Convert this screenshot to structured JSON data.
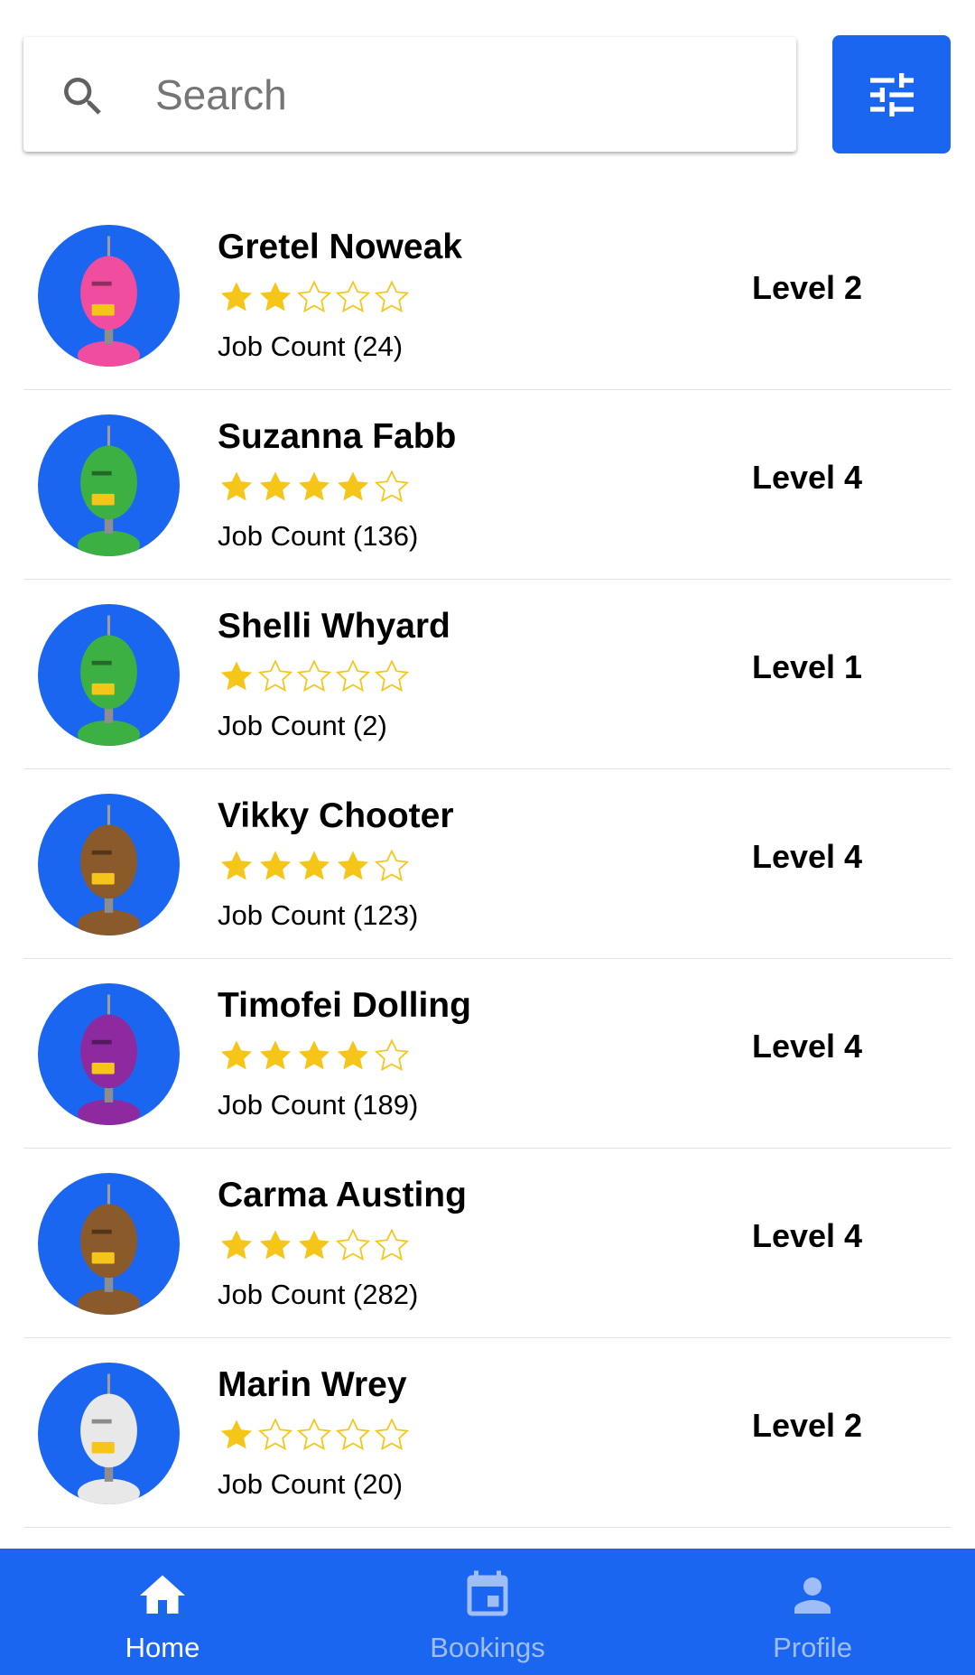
{
  "search": {
    "placeholder": "Search",
    "value": ""
  },
  "accent_color": "#1a66f0",
  "star_color": "#f5c518",
  "workers": [
    {
      "name": "Gretel Noweak",
      "rating": 2,
      "job_count": "Job Count (24)",
      "level": "Level 2",
      "avatar_color": "#f04d9e",
      "avatar_icon": "pink-robot"
    },
    {
      "name": "Suzanna Fabb",
      "rating": 4,
      "job_count": "Job Count (136)",
      "level": "Level 4",
      "avatar_color": "#3cb043",
      "avatar_icon": "green-robot"
    },
    {
      "name": "Shelli Whyard",
      "rating": 1,
      "job_count": "Job Count (2)",
      "level": "Level 1",
      "avatar_color": "#3cb043",
      "avatar_icon": "green-cyclops-robot"
    },
    {
      "name": "Vikky Chooter",
      "rating": 4,
      "job_count": "Job Count (123)",
      "level": "Level 4",
      "avatar_color": "#8b5a2b",
      "avatar_icon": "brown-robot"
    },
    {
      "name": "Timofei Dolling",
      "rating": 4,
      "job_count": "Job Count (189)",
      "level": "Level 4",
      "avatar_color": "#8e2aa0",
      "avatar_icon": "purple-robot"
    },
    {
      "name": "Carma Austing",
      "rating": 3,
      "job_count": "Job Count (282)",
      "level": "Level 4",
      "avatar_color": "#8b5a2b",
      "avatar_icon": "brown-robot"
    },
    {
      "name": "Marin Wrey",
      "rating": 1,
      "job_count": "Job Count (20)",
      "level": "Level 2",
      "avatar_color": "#e8e8e8",
      "avatar_icon": "white-robot"
    }
  ],
  "nav": {
    "home": "Home",
    "bookings": "Bookings",
    "profile": "Profile",
    "active": "home"
  }
}
